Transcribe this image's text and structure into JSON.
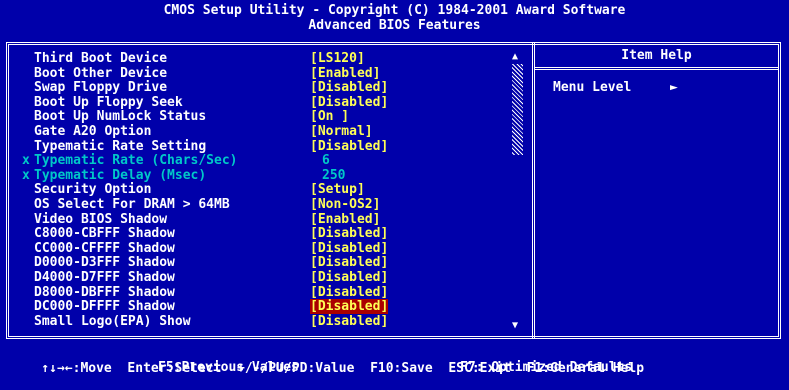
{
  "header": {
    "title": "CMOS Setup Utility - Copyright (C) 1984-2001 Award Software",
    "subtitle": "Advanced BIOS Features"
  },
  "settings": [
    {
      "label": "Third Boot Device",
      "value": "[LS120]",
      "disabled": false,
      "marker": ""
    },
    {
      "label": "Boot Other Device",
      "value": "[Enabled]",
      "disabled": false,
      "marker": ""
    },
    {
      "label": "Swap Floppy Drive",
      "value": "[Disabled]",
      "disabled": false,
      "marker": ""
    },
    {
      "label": "Boot Up Floppy Seek",
      "value": "[Disabled]",
      "disabled": false,
      "marker": ""
    },
    {
      "label": "Boot Up NumLock Status",
      "value": "[On ]",
      "disabled": false,
      "marker": ""
    },
    {
      "label": "Gate A20 Option",
      "value": "[Normal]",
      "disabled": false,
      "marker": ""
    },
    {
      "label": "Typematic Rate Setting",
      "value": "[Disabled]",
      "disabled": false,
      "marker": ""
    },
    {
      "label": "Typematic Rate (Chars/Sec)",
      "value": "6",
      "disabled": true,
      "marker": "x"
    },
    {
      "label": "Typematic Delay (Msec)",
      "value": "250",
      "disabled": true,
      "marker": "x"
    },
    {
      "label": "Security Option",
      "value": "[Setup]",
      "disabled": false,
      "marker": ""
    },
    {
      "label": "OS Select For DRAM > 64MB",
      "value": "[Non-OS2]",
      "disabled": false,
      "marker": ""
    },
    {
      "label": "Video BIOS Shadow",
      "value": "[Enabled]",
      "disabled": false,
      "marker": ""
    },
    {
      "label": "C8000-CBFFF Shadow",
      "value": "[Disabled]",
      "disabled": false,
      "marker": ""
    },
    {
      "label": "CC000-CFFFF Shadow",
      "value": "[Disabled]",
      "disabled": false,
      "marker": ""
    },
    {
      "label": "D0000-D3FFF Shadow",
      "value": "[Disabled]",
      "disabled": false,
      "marker": ""
    },
    {
      "label": "D4000-D7FFF Shadow",
      "value": "[Disabled]",
      "disabled": false,
      "marker": ""
    },
    {
      "label": "D8000-DBFFF Shadow",
      "value": "[Disabled]",
      "disabled": false,
      "marker": ""
    },
    {
      "label": "DC000-DFFFF Shadow",
      "value": "[Disabled]",
      "disabled": false,
      "marker": "",
      "selected": true
    },
    {
      "label": "Small Logo(EPA) Show",
      "value": "[Disabled]",
      "disabled": false,
      "marker": ""
    }
  ],
  "help": {
    "title": "Item Help",
    "menu_level": "Menu Level",
    "menu_arrow": "►"
  },
  "scrollbar": {
    "up": "▲",
    "down": "▼"
  },
  "footer": {
    "move": "↑↓→←:Move",
    "select": "Enter:Select",
    "value": "+/-/PU/PD:Value",
    "save": "F10:Save",
    "exit": "ESC:Exit",
    "help": "F1:General Help",
    "previous": "F5:Previous Values",
    "optimized": "F7: Optimized Defaults"
  },
  "colors": {
    "background": "#0000aa",
    "text": "#ffffff",
    "value": "#ffff55",
    "disabled": "#00c8c8",
    "highlight": "#aa0000"
  }
}
